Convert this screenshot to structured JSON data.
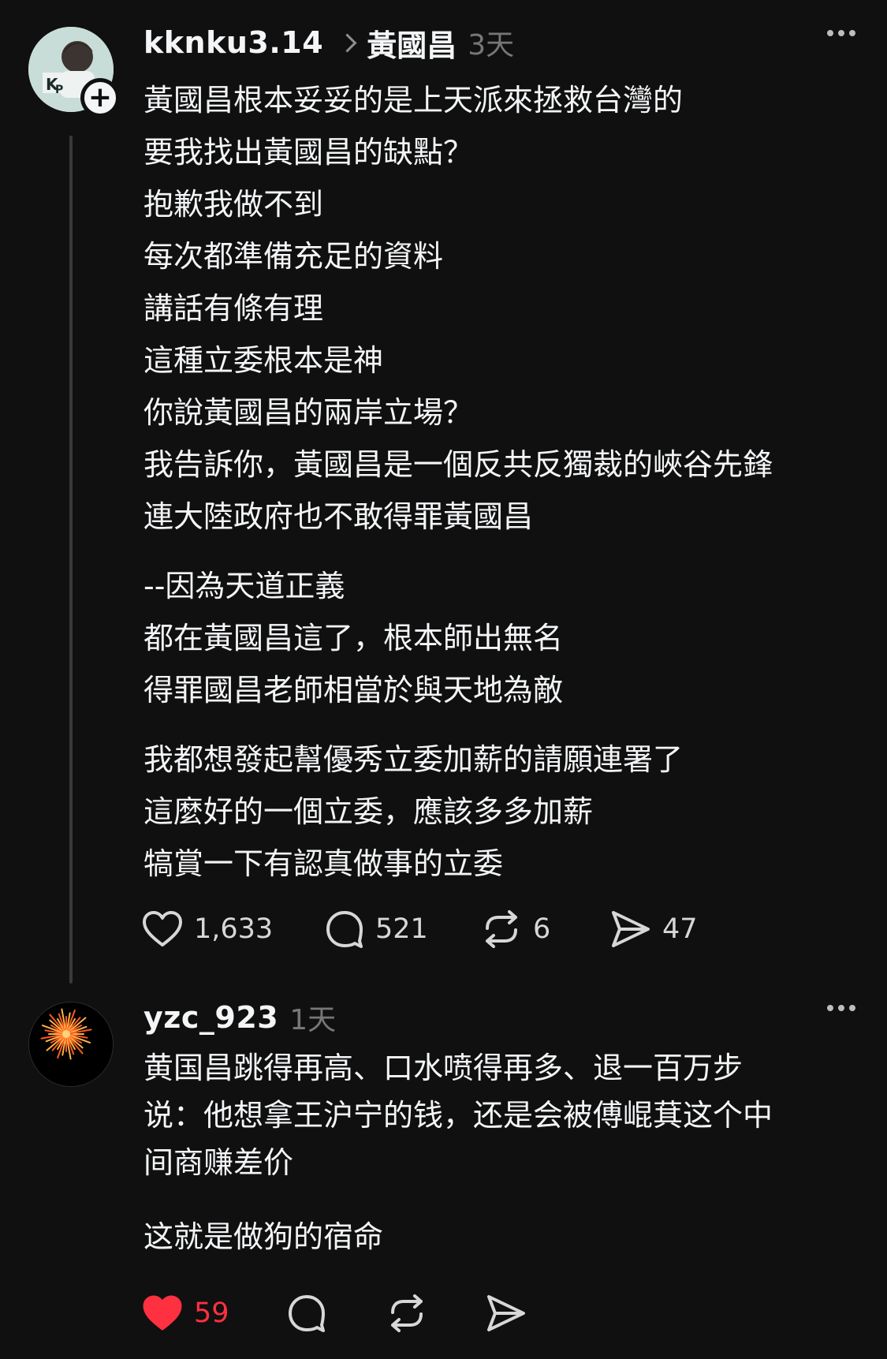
{
  "posts": [
    {
      "username": "kknku3.14",
      "reply_to": "黃國昌",
      "time": "3天",
      "lines": [
        "黃國昌根本妥妥的是上天派來拯救台灣的",
        "要我找出黃國昌的缺點？",
        "抱歉我做不到",
        "每次都準備充足的資料",
        "講話有條有理",
        "這種立委根本是神",
        "你說黃國昌的兩岸立場？",
        "我告訴你，黃國昌是一個反共反獨裁的峽谷先鋒",
        "連大陸政府也不敢得罪黃國昌",
        "",
        "--因為天道正義",
        "都在黃國昌這了，根本師出無名",
        "得罪國昌老師相當於與天地為敵",
        "",
        "我都想發起幫優秀立委加薪的請願連署了",
        "這麼好的一個立委，應該多多加薪",
        "犒賞一下有認真做事的立委"
      ],
      "likes": "1,633",
      "comments": "521",
      "reposts": "6",
      "shares": "47",
      "liked": false
    },
    {
      "username": "yzc_923",
      "time": "1天",
      "lines": [
        "黄国昌跳得再高、口水喷得再多、退一百万步",
        "说：他想拿王沪宁的钱，还是会被傅崐萁这个中",
        "间商赚差价",
        "",
        "这就是做狗的宿命"
      ],
      "likes": "59",
      "liked": true
    }
  ],
  "icons": {
    "like": "heart-icon",
    "comment": "comment-bubble-icon",
    "repost": "repost-arrows-icon",
    "share": "send-icon",
    "more": "more-dots-icon",
    "follow": "plus-icon"
  },
  "colors": {
    "background": "#101010",
    "text": "#f3f5f7",
    "muted": "#777777",
    "like_active": "#ff3040"
  }
}
